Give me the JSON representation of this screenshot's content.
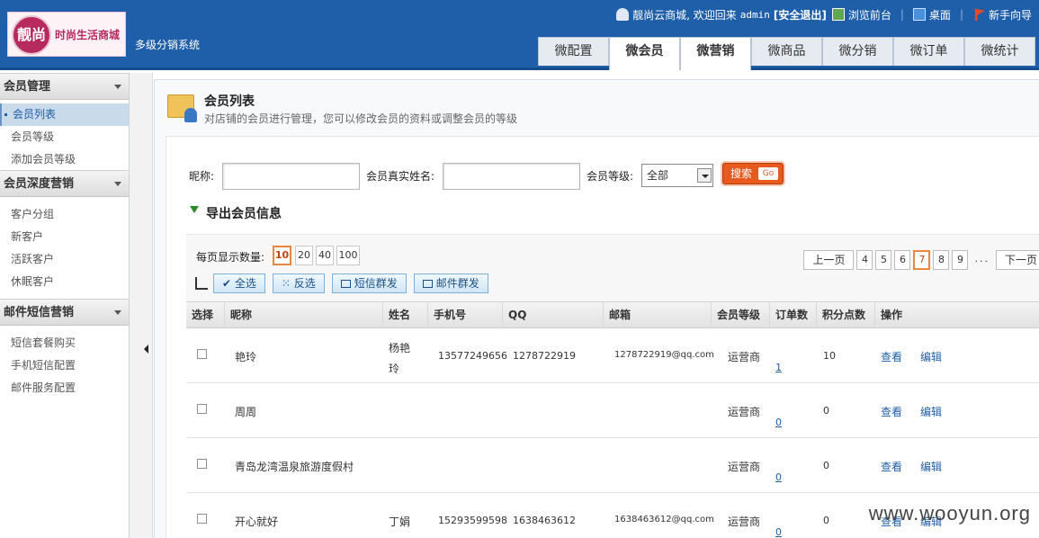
{
  "header": {
    "logo_mark": "靓尚",
    "logo_text": "时尚生活商城",
    "system_name": "多级分销系统",
    "welcome": "靓尚云商城, 欢迎回来",
    "username": "admin",
    "logout": "[安全退出]",
    "browse_front": "浏览前台",
    "desktop": "桌面",
    "guide": "新手向导",
    "nav": [
      "微配置",
      "微会员",
      "微营销",
      "微商品",
      "微分销",
      "微订单",
      "微统计"
    ]
  },
  "sidebar": {
    "sections": [
      {
        "title": "会员管理",
        "items": [
          "会员列表",
          "会员等级",
          "添加会员等级"
        ]
      },
      {
        "title": "会员深度营销",
        "items": [
          "客户分组",
          "新客户",
          "活跃客户",
          "休眠客户"
        ]
      },
      {
        "title": "邮件短信营销",
        "items": [
          "短信套餐购买",
          "手机短信配置",
          "邮件服务配置"
        ]
      }
    ]
  },
  "page": {
    "title": "会员列表",
    "desc": "对店铺的会员进行管理，您可以修改会员的资料或调整会员的等级"
  },
  "search": {
    "nickname_label": "昵称:",
    "realname_label": "会员真实姓名:",
    "level_label": "会员等级:",
    "level_value": "全部",
    "search_button": "搜索",
    "go_label": "Go",
    "export_label": "导出会员信息"
  },
  "list": {
    "page_size_label": "每页显示数量:",
    "page_sizes": [
      "10",
      "20",
      "40",
      "100"
    ],
    "pager": [
      "上一页",
      "4",
      "5",
      "6",
      "7",
      "8",
      "9",
      "...",
      "下一页"
    ],
    "tools": [
      "全选",
      "反选",
      "短信群发",
      "邮件群发"
    ],
    "columns": [
      "选择",
      "昵称",
      "姓名",
      "手机号",
      "QQ",
      "邮箱",
      "会员等级",
      "订单数",
      "积分点数",
      "操作"
    ],
    "rows": [
      {
        "nick": "艳玲",
        "real": "杨艳玲",
        "mobile": "13577249656",
        "qq": "1278722919",
        "email": "1278722919@qq.com",
        "level": "运营商",
        "orders": "1",
        "points": "10",
        "view": "查看",
        "edit": "编辑"
      },
      {
        "nick": "周周",
        "real": "",
        "mobile": "",
        "qq": "",
        "email": "",
        "level": "运营商",
        "orders": "0",
        "points": "0",
        "view": "查看",
        "edit": "编辑"
      },
      {
        "nick": "青岛龙湾温泉旅游度假村",
        "real": "",
        "mobile": "",
        "qq": "",
        "email": "",
        "level": "运营商",
        "orders": "0",
        "points": "0",
        "view": "查看",
        "edit": "编辑"
      },
      {
        "nick": "开心就好",
        "real": "丁娟",
        "mobile": "15293599598",
        "qq": "1638463612",
        "email": "1638463612@qq.com",
        "level": "运营商",
        "orders": "0",
        "points": "0",
        "view": "查看",
        "edit": "编辑"
      }
    ]
  },
  "watermark": "www.wooyun.org"
}
